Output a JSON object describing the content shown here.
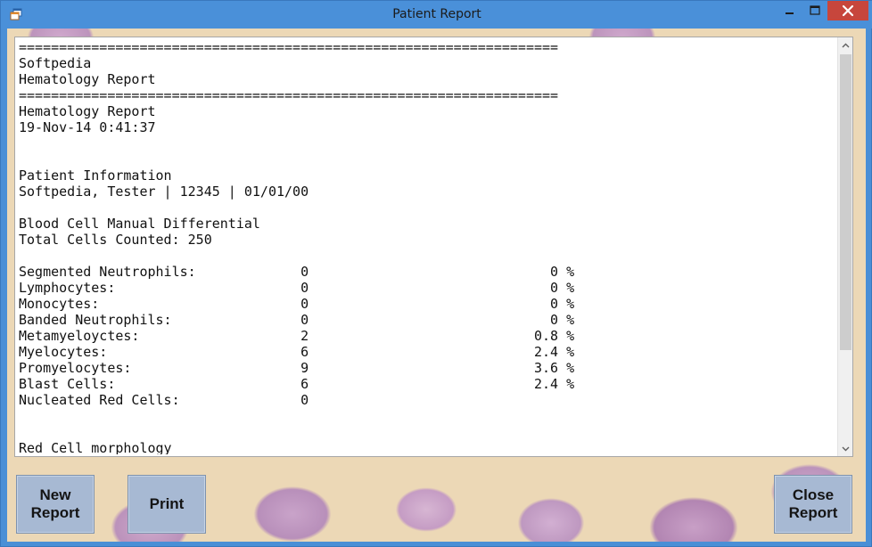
{
  "window": {
    "title": "Patient Report"
  },
  "icons": {
    "app": "app-window-icon",
    "minimize": "minimize-icon",
    "maximize": "maximize-icon",
    "close": "close-icon",
    "scroll_up": "chevron-up-icon",
    "scroll_down": "chevron-down-icon"
  },
  "colors": {
    "titlebar": "#4a90d9",
    "close_button": "#c7463c",
    "button_face": "#a7b9d3",
    "background": "#ecd8b6"
  },
  "report": {
    "lines": [
      "===================================================================",
      "Softpedia",
      "Hematology Report",
      "===================================================================",
      "Hematology Report",
      "19-Nov-14 0:41:37",
      "",
      "",
      "Patient Information",
      "Softpedia, Tester | 12345 | 01/01/00",
      "",
      "Blood Cell Manual Differential",
      "Total Cells Counted: 250",
      "",
      "Segmented Neutrophils:             0                              0 %",
      "Lymphocytes:                       0                              0 %",
      "Monocytes:                         0                              0 %",
      "Banded Neutrophils:                0                              0 %",
      "Metamyeloyctes:                    2                            0.8 %",
      "Myelocytes:                        6                            2.4 %",
      "Promyelocytes:                     9                            3.6 %",
      "Blast Cells:                       6                            2.4 %",
      "Nucleated Red Cells:               0",
      "",
      "",
      "Red Cell morphology"
    ]
  },
  "buttons": {
    "new_report": "New\nReport",
    "print": "Print",
    "close_report": "Close\nReport"
  }
}
